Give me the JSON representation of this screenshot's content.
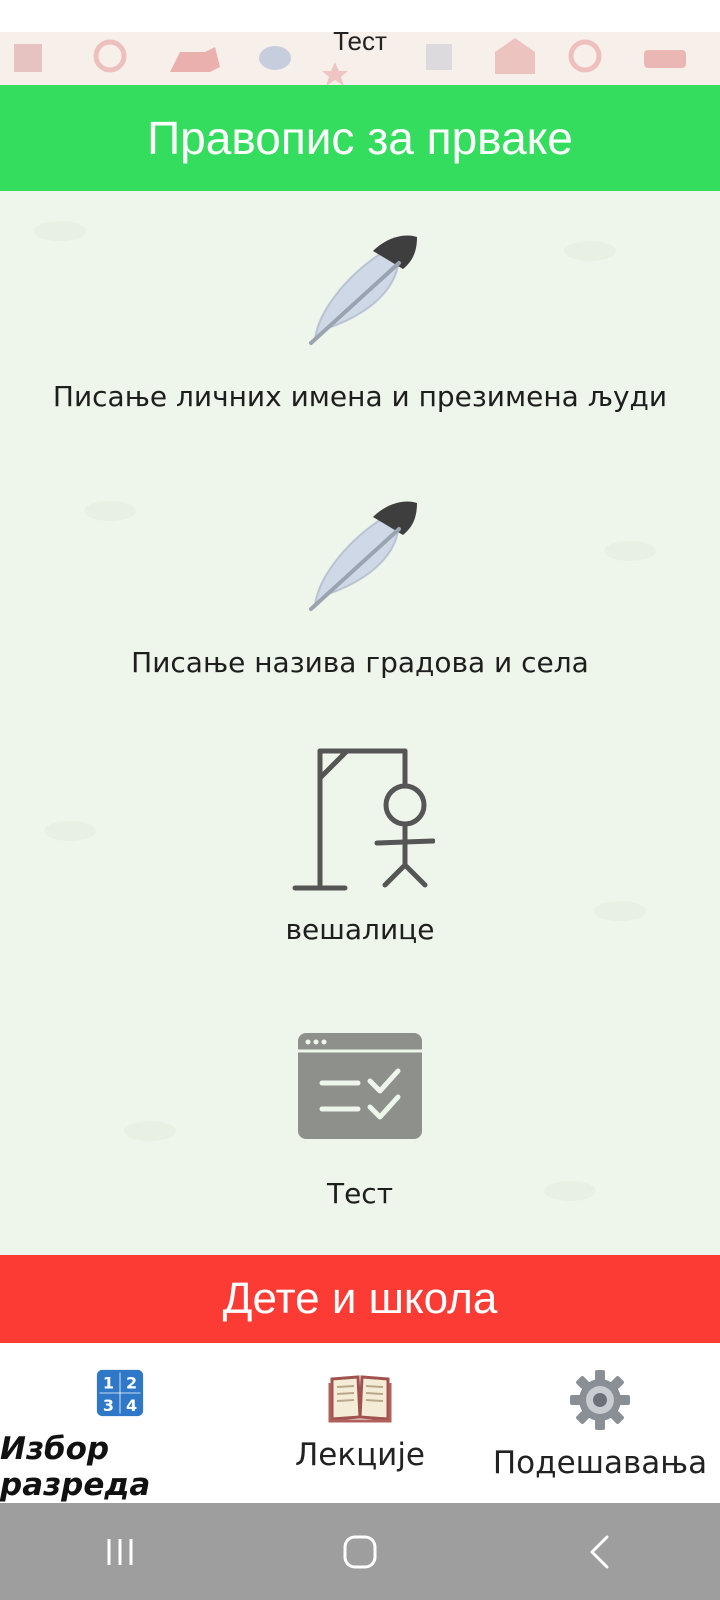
{
  "top_strip": {
    "partial_label": "Тест"
  },
  "header": {
    "title": "Правопис за прваке"
  },
  "lessons": [
    {
      "label": "Писање личних имена и презимена људи",
      "icon": "feather-icon"
    },
    {
      "label": "Писање назива градова и села",
      "icon": "feather-icon"
    },
    {
      "label": "вешалице",
      "icon": "hangman-icon"
    },
    {
      "label": "Тест",
      "icon": "checklist-window-icon"
    }
  ],
  "footer_banner": {
    "title": "Дете и школа"
  },
  "bottom_nav": [
    {
      "label": "Избор разреда",
      "icon": "numbers-1234-icon",
      "active": true
    },
    {
      "label": "Лекције",
      "icon": "open-book-icon",
      "active": false
    },
    {
      "label": "Подешавања",
      "icon": "gear-icon",
      "active": false
    }
  ],
  "colors": {
    "header_green": "#35dd5f",
    "footer_red": "#fc3b35",
    "content_bg": "#eef5ea",
    "system_nav": "#9e9e9e"
  }
}
